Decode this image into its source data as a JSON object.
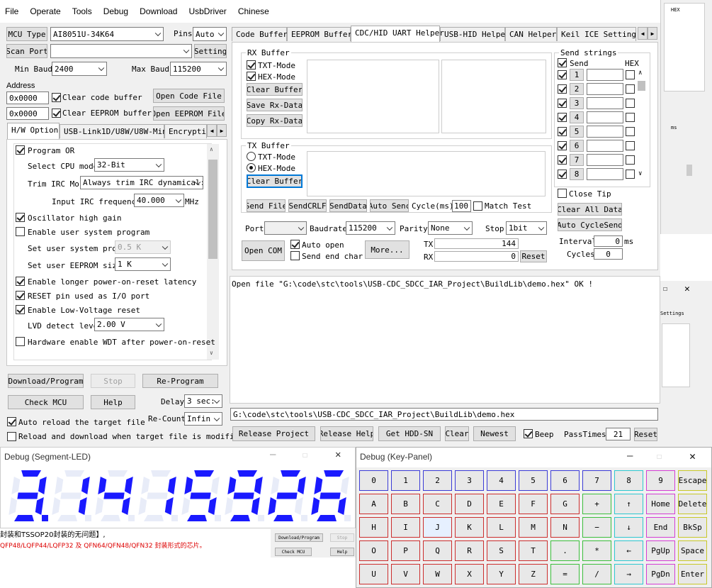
{
  "menu": [
    "File",
    "Operate",
    "Tools",
    "Debug",
    "Download",
    "UsbDriver",
    "Chinese"
  ],
  "left": {
    "mcu_type_label": "MCU Type",
    "mcu_type": "AI8051U-34K64",
    "pins_label": "Pins",
    "pins": "Auto",
    "scan_port": "Scan Port",
    "port_value": "",
    "setting": "Setting",
    "min_baud_label": "Min Baud",
    "min_baud": "2400",
    "max_baud_label": "Max Baud",
    "max_baud": "115200",
    "address_label": "Address",
    "addr1": "0x0000",
    "addr2": "0x0000",
    "clear_code": "Clear code buffer",
    "clear_eeprom": "Clear EEPROM buffer",
    "open_code": "Open Code File",
    "open_eeprom": "Open EEPROM File",
    "tabs": [
      "H/W Option",
      "USB-Link1D/U8W/U8W-Mini",
      "Encrypti"
    ],
    "options": {
      "program_or": "Program OR",
      "cpu_mode_label": "Select CPU mode",
      "cpu_mode": "32-Bit",
      "trim_label": "Trim IRC Mo",
      "trim": "Always trim IRC dynamical:",
      "irc_freq_label": "Input IRC frequency",
      "irc_freq": "40.000",
      "mhz": "MHz",
      "osc_gain": "Oscillator high gain",
      "enable_user": "Enable user system program",
      "set_user_prog": "Set user system prog",
      "set_user_prog_val": "0.5 K",
      "set_user_eeprom": "Set user EEPROM size",
      "set_user_eeprom_val": "1  K",
      "longer_latency": "Enable longer power-on-reset latency",
      "reset_io": "RESET pin used as I/O port",
      "low_voltage": "Enable Low-Voltage reset",
      "lvd_label": "LVD detect leve",
      "lvd": "2.00 V",
      "hw_wdt": "Hardware enable WDT after power-on-reset"
    },
    "download": "Download/Program",
    "stop": "Stop",
    "reprogram": "Re-Program",
    "check_mcu": "Check MCU",
    "help": "Help",
    "delay_label": "Delay",
    "delay": "3 sec:",
    "auto_reload": "Auto reload the target file",
    "recount_label": "Re-Count",
    "recount": "Infin",
    "reload_download": "Reload and download when target file is modified"
  },
  "right": {
    "tabs": [
      "Code Buffer",
      "EEPROM Buffer",
      "CDC/HID UART Helper",
      "USB-HID Helper",
      "CAN Helper",
      "Keil ICE Settings"
    ],
    "rx_buffer": "RX Buffer",
    "txt_mode": "TXT-Mode",
    "hex_mode": "HEX-Mode",
    "clear_buffer": "Clear Buffer",
    "save_rx": "Save Rx-Data",
    "copy_rx": "Copy Rx-Data",
    "tx_buffer": "TX Buffer",
    "send_file": "Send File",
    "send_crlf": "SendCRLF",
    "send_data": "SendData",
    "auto_send": "Auto Senc",
    "cycle_label": "Cycle(ms)",
    "cycle": "100",
    "match_test": "Match Test",
    "send_strings": "Send strings",
    "send_hdr": "Send",
    "hex_hdr": "HEX",
    "rows": [
      "1",
      "2",
      "3",
      "4",
      "5",
      "6",
      "7",
      "8"
    ],
    "close_tip": "Close Tip",
    "clear_all": "Clear All Data",
    "auto_cycle": "Auto CycleSend",
    "interval_label": "Interval",
    "interval": "0",
    "ms": "ms",
    "cycles_label": "Cycles",
    "cycles": "0",
    "port_label": "Port",
    "baud_label": "Baudrate",
    "baud": "115200",
    "parity_label": "Parity",
    "parity": "None",
    "stop_label": "Stop",
    "stop": "1bit",
    "open_com": "Open COM",
    "auto_open": "Auto open",
    "send_end": "Send end char",
    "more": "More...",
    "tx_label": "TX",
    "tx": "144",
    "rx_label": "RX",
    "rx": "0",
    "reset": "Reset"
  },
  "log": "Open file \"G:\\code\\stc\\tools\\USB-CDC_SDCC_IAR_Project\\BuildLib\\demo.hex\" OK !",
  "path": "G:\\code\\stc\\tools\\USB-CDC_SDCC_IAR_Project\\BuildLib\\demo.hex",
  "bottom": {
    "release_project": "Release Project",
    "release_help": "Release Help",
    "get_hdd": "Get HDD-SN",
    "clear": "Clear",
    "newest": "Newest",
    "beep": "Beep",
    "passtimes_label": "PassTimes",
    "passtimes": "21",
    "reset": "Reset"
  },
  "seg_led": {
    "title": "Debug (Segment-LED)",
    "digits": "3.1415926"
  },
  "key_panel": {
    "title": "Debug (Key-Panel)",
    "rows": [
      [
        "0",
        "1",
        "2",
        "3",
        "4",
        "5",
        "6",
        "7",
        "8",
        "9",
        "Escape"
      ],
      [
        "A",
        "B",
        "C",
        "D",
        "E",
        "F",
        "G",
        "+",
        "↑",
        "Home",
        "Delete"
      ],
      [
        "H",
        "I",
        "J",
        "K",
        "L",
        "M",
        "N",
        "−",
        "↓",
        "End",
        "BkSp"
      ],
      [
        "O",
        "P",
        "Q",
        "R",
        "S",
        "T",
        ".",
        "*",
        "←",
        "PgUp",
        "Space"
      ],
      [
        "U",
        "V",
        "W",
        "X",
        "Y",
        "Z",
        "=",
        "/",
        "→",
        "PgDn",
        "Enter"
      ]
    ]
  },
  "bg_text": {
    "line1": "封装和TSSOP20封装的无问题】,",
    "line2": "QFP48/LQFP44/LQFP32 及 QFN64/QFN48/QFN32 封装形式的芯片。",
    "ghost_dl": "Download/Program",
    "ghost_stop": "Stop",
    "ghost_check": "Check MCU",
    "ghost_help": "Help",
    "ghost_settings": "Settings",
    "ghost_hex": "HEX",
    "ghost_ms": "ms"
  },
  "colors": {
    "led": "#1a1aff",
    "led_off": "#e8ecf8",
    "blue": "#3b3bd6",
    "red": "#cc2e2e",
    "green": "#3cbf3c",
    "cyan": "#2ec8d0",
    "magenta": "#d43dd4",
    "yellow": "#c8c828"
  }
}
